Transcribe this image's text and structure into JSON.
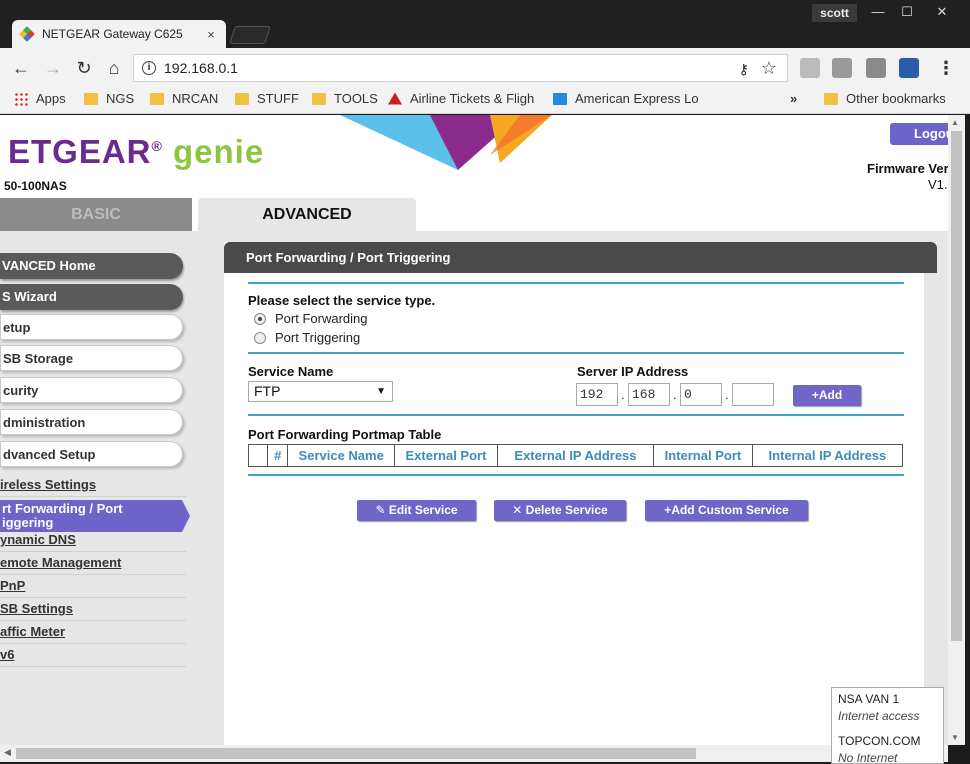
{
  "browser": {
    "tab_title": "NETGEAR Gateway C625",
    "tab_close": "×",
    "profile": "scott",
    "window_controls": [
      "—",
      "☐",
      "✕"
    ],
    "url": "192.168.0.1",
    "bookmarks": [
      {
        "label": "Apps",
        "icon": "apps-grid-icon"
      },
      {
        "label": "NGS",
        "icon": "folder-icon"
      },
      {
        "label": "NRCAN",
        "icon": "folder-icon"
      },
      {
        "label": "STUFF",
        "icon": "folder-icon"
      },
      {
        "label": "TOOLS",
        "icon": "folder-icon"
      },
      {
        "label": "Airline Tickets & Fligh",
        "icon": "airline-icon"
      },
      {
        "label": "American Express Lo",
        "icon": "amex-icon"
      },
      {
        "label": "»",
        "icon": ""
      },
      {
        "label": "Other bookmarks",
        "icon": "folder-icon"
      }
    ]
  },
  "header": {
    "logo_brand": "ETGEAR",
    "logo_reg": "®",
    "logo_product": "genie",
    "model": "50-100NAS",
    "logout": "Logou",
    "firmware_label": "Firmware Ver",
    "firmware_value": "V1."
  },
  "tabs": {
    "basic": "BASIC",
    "advanced": "ADVANCED"
  },
  "sidebar": {
    "buttons": [
      {
        "label": "VANCED Home",
        "style": "dark"
      },
      {
        "label": "S Wizard",
        "style": "dark"
      },
      {
        "label": "etup",
        "style": "light"
      },
      {
        "label": "SB Storage",
        "style": "light"
      },
      {
        "label": "curity",
        "style": "light"
      },
      {
        "label": "dministration",
        "style": "light"
      },
      {
        "label": "dvanced Setup",
        "style": "light"
      }
    ],
    "links": [
      "ireless Settings",
      "ynamic DNS",
      "emote Management",
      "PnP",
      "SB Settings",
      "affic Meter",
      "v6"
    ],
    "active": "rt Forwarding / Port Triggering",
    "active_line1": "rt Forwarding / Port",
    "active_line2": "iggering"
  },
  "panel": {
    "title": "Port Forwarding / Port Triggering",
    "service_type_label": "Please select the service type.",
    "radio_forwarding": "Port Forwarding",
    "radio_triggering": "Port Triggering",
    "selected_type": "Port Forwarding",
    "service_name_label": "Service Name",
    "service_name_value": "FTP",
    "server_ip_label": "Server IP Address",
    "ip": [
      "192",
      "168",
      "0",
      ""
    ],
    "add_button": "Add",
    "table_title": "Port Forwarding Portmap Table",
    "table_headers": [
      "",
      "#",
      "Service Name",
      "External Port",
      "External IP Address",
      "Internal Port",
      "Internal IP Address"
    ],
    "edit_button": "Edit Service",
    "delete_button": "Delete Service",
    "add_custom_button": "Add Custom Service"
  },
  "network_popup": {
    "net1_name": "NSA VAN 1",
    "net1_status": "Internet access",
    "net2_name": "TOPCON.COM",
    "net2_status": "No Internet access"
  },
  "colors": {
    "accent_purple": "#6e63c8",
    "rule_blue": "#41a1c4",
    "header_dark": "#4a4a4a",
    "genie_green": "#8cc63f"
  }
}
